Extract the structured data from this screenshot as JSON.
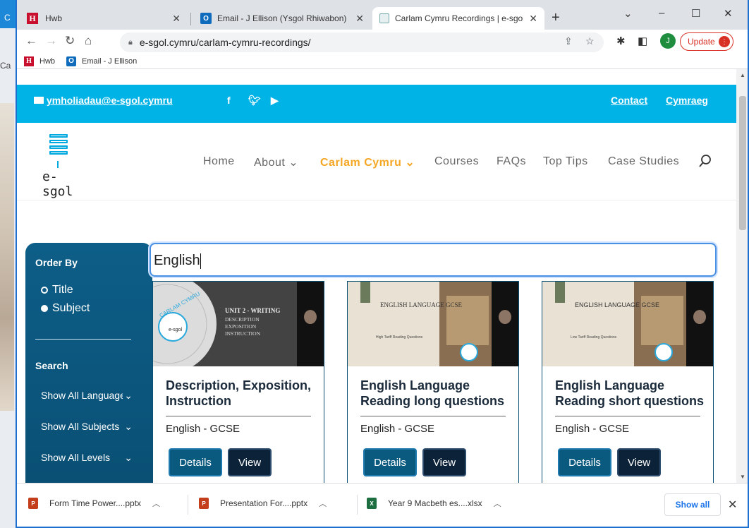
{
  "background": {
    "tab_fragment": "C",
    "side_text": "Ca"
  },
  "browser": {
    "tabs": [
      {
        "title": "Hwb",
        "favicon": "hwb-icon"
      },
      {
        "title": "Email - J Ellison (Ysgol Rhiwabon)",
        "favicon": "outlook-icon"
      },
      {
        "title": "Carlam Cymru Recordings | e-sgol",
        "favicon": "page-icon"
      }
    ],
    "new_tab": "+",
    "url": "e-sgol.cymru/carlam-cymru-recordings/",
    "avatar_letter": "J",
    "update_label": "Update",
    "bookmarks": [
      {
        "label": "Hwb",
        "icon": "hwb-icon"
      },
      {
        "label": "Email - J Ellison",
        "icon": "outlook-icon"
      }
    ]
  },
  "site": {
    "topbar": {
      "email": "ymholiadau@e-sgol.cymru",
      "contact": "Contact",
      "language": "Cymraeg"
    },
    "logo_text": "e-sgol",
    "nav": [
      "Home",
      "About ⌄",
      "Carlam Cymru ⌄",
      "Courses",
      "FAQs",
      "Top Tips",
      "Case Studies"
    ],
    "sidebar": {
      "order_heading": "Order By",
      "order_options": [
        "Title",
        "Subject"
      ],
      "search_heading": "Search",
      "filters": [
        "Show All Languages",
        "Show All Subjects",
        "Show All Levels"
      ]
    },
    "search_value": "English",
    "cards": [
      {
        "title": "Description, Exposition, Instruction",
        "subject": "English - GCSE",
        "slide_heading": "UNIT 2 - WRITING",
        "slide_lines": [
          "DESCRIPTION",
          "EXPOSITION",
          "INSTRUCTION"
        ],
        "slide_badge": "CARLAM CYMRU",
        "details": "Details",
        "view": "View"
      },
      {
        "title": "English Language Reading long questions",
        "subject": "English - GCSE",
        "slide_heading": "ENGLISH LANGUAGE GCSE",
        "slide_sub": "High Tariff Reading Questions",
        "details": "Details",
        "view": "View"
      },
      {
        "title": "English Language Reading short questions",
        "subject": "English - GCSE",
        "slide_heading": "ENGLISH LANGUAGE GCSE",
        "slide_sub": "Low Tariff Reading Questions",
        "details": "Details",
        "view": "View"
      }
    ]
  },
  "downloads": {
    "items": [
      {
        "name": "Form Time Power....pptx",
        "type": "pptx"
      },
      {
        "name": "Presentation For....pptx",
        "type": "pptx"
      },
      {
        "name": "Year 9 Macbeth es....xlsx",
        "type": "xlsx"
      }
    ],
    "show_all": "Show all"
  },
  "colors": {
    "accent": "#00b3e6",
    "nav_active": "#f5a623",
    "sidebar": "#0d5e88",
    "button": "#0a5a80",
    "view_button": "#0c2238"
  }
}
